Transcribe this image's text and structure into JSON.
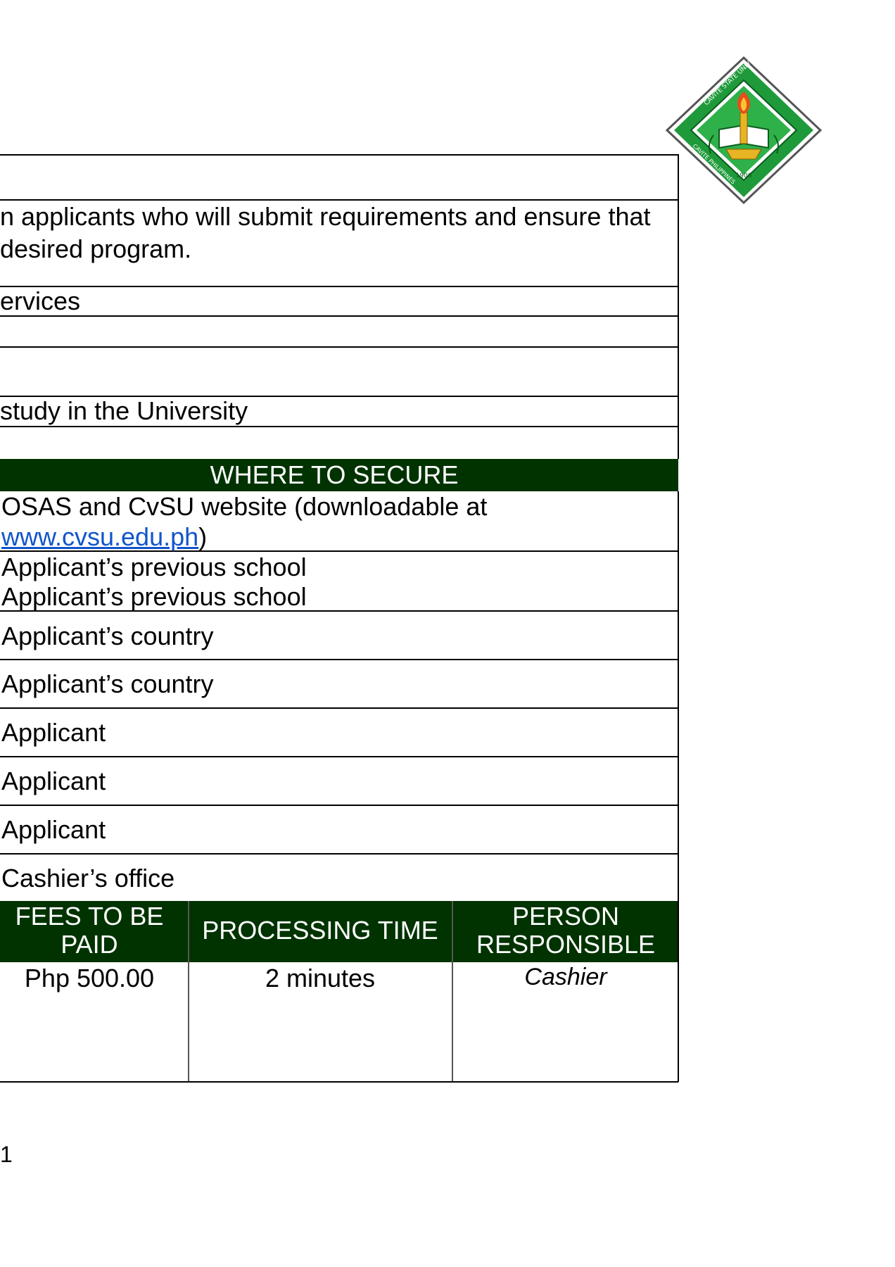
{
  "logo": {
    "seal_text_top": "CAVITE STATE UNIVERSITY",
    "seal_text_bottom": "CAVITE PHILIPPINES",
    "seal_year": "1906",
    "colors": {
      "green": "#1f9a3a",
      "dark_green": "#0b5d1e",
      "gold": "#e7b423"
    }
  },
  "top_rows": [
    {
      "id": "row-1",
      "lines": [
        ""
      ]
    },
    {
      "id": "row-2",
      "lines": [
        "n applicants who will submit requirements and ensure that",
        "desired program."
      ]
    },
    {
      "id": "row-3",
      "lines": [
        "ervices"
      ]
    },
    {
      "id": "row-4",
      "lines": [
        ""
      ]
    },
    {
      "id": "row-5",
      "lines": [
        ""
      ]
    },
    {
      "id": "row-6",
      "lines": [
        " study in the University"
      ]
    },
    {
      "id": "row-7",
      "lines": [
        ""
      ]
    }
  ],
  "secure_header": "WHERE TO SECURE",
  "secure_rows": [
    {
      "line1": "OSAS and CvSU website (downloadable at",
      "link": "www.cvsu.edu.ph",
      "suffix": ")"
    },
    {
      "line1": "Applicant’s previous school",
      "line2": "Applicant’s previous school"
    },
    {
      "line1": "Applicant’s country"
    },
    {
      "line1": "Applicant’s country"
    },
    {
      "line1": "Applicant"
    },
    {
      "line1": "Applicant"
    },
    {
      "line1": "Applicant"
    },
    {
      "line1": "Cashier’s office"
    }
  ],
  "process_headers": {
    "fees_line1": "FEES TO BE",
    "fees_line2": "PAID",
    "processing_time": "PROCESSING TIME",
    "person_line1": "PERSON",
    "person_line2": "RESPONSIBLE"
  },
  "process_row": {
    "fee": "Php 500.00",
    "time": "2 minutes",
    "person": "Cashier"
  },
  "page_number": "1",
  "colors": {
    "header_band": "#003300",
    "link": "#1155cc"
  }
}
